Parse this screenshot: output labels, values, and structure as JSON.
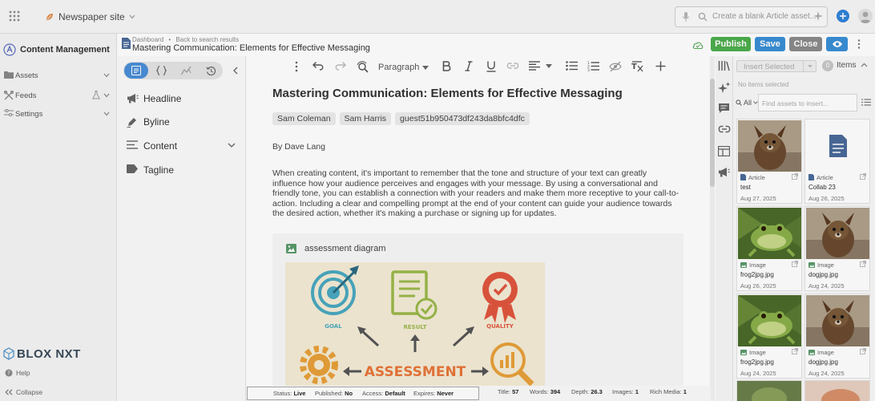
{
  "topbar": {
    "site_name": "Newspaper site",
    "search_placeholder": "Create a blank Article asset..."
  },
  "leftnav": {
    "title": "Content Management",
    "items": [
      {
        "label": "Assets"
      },
      {
        "label": "Feeds"
      },
      {
        "label": "Settings"
      }
    ],
    "brand": "BLOX NXT",
    "help": "Help",
    "collapse": "Collapse"
  },
  "header": {
    "breadcrumb": [
      "Dashboard",
      "Back to search results"
    ],
    "breadcrumb_sep": "•",
    "title": "Mastering Communication: Elements for Effective Messaging",
    "publish_label": "Publish",
    "save_label": "Save",
    "close_label": "Close"
  },
  "structure": {
    "items": [
      {
        "label": "Headline"
      },
      {
        "label": "Byline"
      },
      {
        "label": "Content"
      },
      {
        "label": "Tagline"
      }
    ]
  },
  "editor": {
    "paragraph_style": "Paragraph",
    "headline": "Mastering Communication: Elements for Effective Messaging",
    "authors": [
      "Sam Coleman",
      "Sam Harris",
      "guest51b950473df243da8bfc4dfc"
    ],
    "byline": "By Dave Lang",
    "body": "When creating content, it's important to remember that the tone and structure of your text can greatly influence how your audience perceives and engages with your message. By using a conversational and friendly tone, you can establish a connection with your readers and make them more receptive to your call-to-action. Including a clear and compelling prompt at the end of your content can guide your audience towards the desired action, whether it's making a purchase or signing up for updates.",
    "image_caption": "assessment diagram",
    "diagram": {
      "goal": "GOAL",
      "result": "RESULT",
      "quality": "QUALITY",
      "center": "ASSESSMENT"
    }
  },
  "statusbar": {
    "status_label": "Status:",
    "status_value": "Live",
    "published_label": "Published:",
    "published_value": "No",
    "access_label": "Access:",
    "access_value": "Default",
    "expires_label": "Expires:",
    "expires_value": "Never",
    "title_label": "Title:",
    "title_value": "57",
    "words_label": "Words:",
    "words_value": "394",
    "depth_label": "Depth:",
    "depth_value": "26.3",
    "images_label": "Images:",
    "images_value": "1",
    "richmedia_label": "Rich Media:",
    "richmedia_value": "1"
  },
  "assets": {
    "insert_selected": "Insert Selected",
    "items_count": "0",
    "items_label": "Items",
    "no_items": "No items selected",
    "filter": "All",
    "search_placeholder": "Find assets to insert...",
    "cards": [
      {
        "type": "Article",
        "name": "test",
        "date": "Aug 27, 2025",
        "thumb": "dog"
      },
      {
        "type": "Article",
        "name": "Collab 23",
        "date": "Aug 26, 2025",
        "thumb": "doc"
      },
      {
        "type": "Image",
        "name": "frog2jpg.jpg",
        "date": "Aug 26, 2025",
        "thumb": "frog"
      },
      {
        "type": "Image",
        "name": "dogjpg.jpg",
        "date": "Aug 24, 2025",
        "thumb": "dog"
      },
      {
        "type": "Image",
        "name": "frog2jpg.jpg",
        "date": "Aug 24, 2025",
        "thumb": "frog"
      },
      {
        "type": "Image",
        "name": "dogjpg.jpg",
        "date": "Aug 24, 2025",
        "thumb": "dog"
      }
    ]
  },
  "colors": {
    "accent": "#3a8fd6",
    "publish": "#4cae4c",
    "close": "#8a8a8a"
  }
}
